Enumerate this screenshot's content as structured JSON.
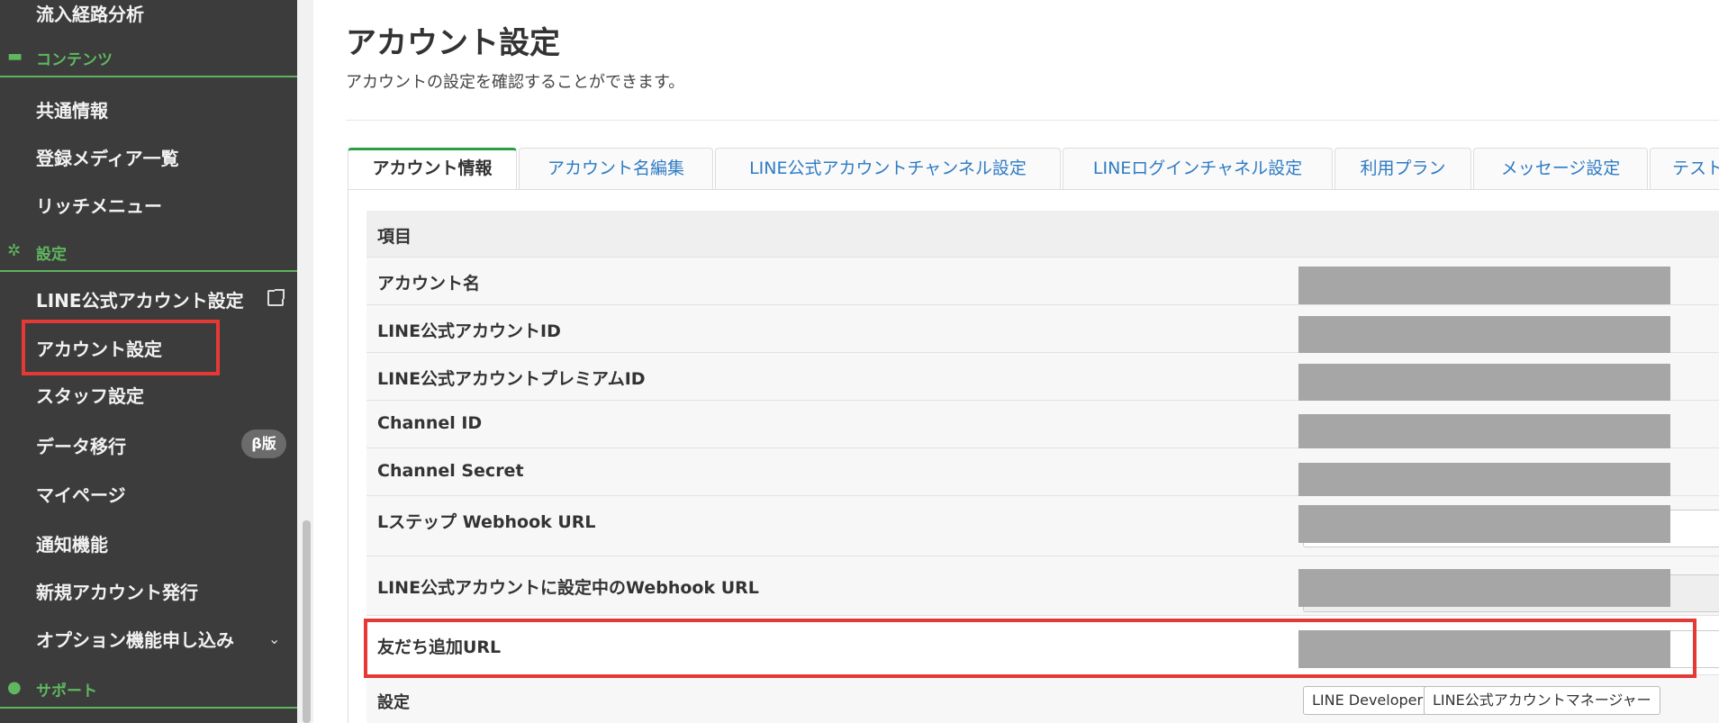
{
  "sidebar": {
    "top_item": "流入経路分析",
    "content_section": "コンテンツ",
    "content_items": [
      "共通情報",
      "登録メディア一覧",
      "リッチメニュー"
    ],
    "settings_section": "設定",
    "settings_items": {
      "line_official": "LINE公式アカウント設定",
      "account": "アカウント設定",
      "staff": "スタッフ設定",
      "data_migration": "データ移行",
      "beta_badge": "β版",
      "mypage": "マイページ",
      "notification": "通知機能",
      "new_account": "新規アカウント発行",
      "option": "オプション機能申し込み"
    },
    "support_section": "サポート"
  },
  "header": {
    "title": "アカウント設定",
    "description": "アカウントの設定を確認することができます。"
  },
  "tabs": [
    "アカウント情報",
    "アカウント名編集",
    "LINE公式アカウントチャンネル設定",
    "LINEログインチャネル設定",
    "利用プラン",
    "メッセージ設定",
    "テスト"
  ],
  "table": {
    "header": "項目",
    "rows": {
      "account_name": "アカウント名",
      "line_id": "LINE公式アカウントID",
      "premium_id": "LINE公式アカウントプレミアムID",
      "channel_id": "Channel ID",
      "channel_secret": "Channel Secret",
      "webhook": "Lステップ Webhook URL",
      "current_webhook": "LINE公式アカウントに設定中のWebhook URL",
      "friend_url": "友だち追加URL",
      "settings": "設定"
    },
    "buttons": {
      "developers": "LINE Developers",
      "manager": "LINE公式アカウントマネージャー"
    }
  }
}
